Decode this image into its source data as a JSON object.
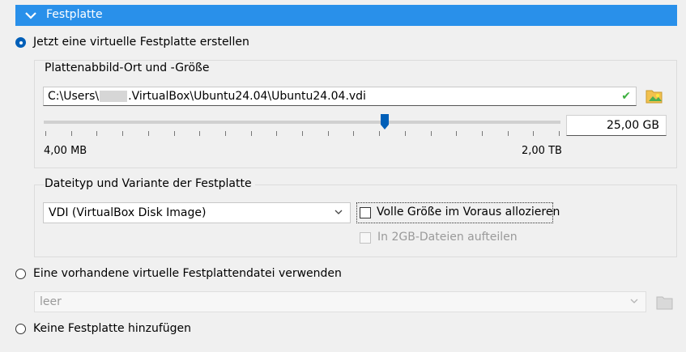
{
  "section": {
    "title": "Festplatte"
  },
  "options": {
    "create_new": {
      "label": "Jetzt eine virtuelle Festplatte erstellen",
      "selected": true
    },
    "use_existing": {
      "label": "Eine vorhandene virtuelle Festplattendatei verwenden",
      "selected": false
    },
    "no_disk": {
      "label": "Keine Festplatte hinzufügen",
      "selected": false
    }
  },
  "location_group": {
    "title": "Plattenabbild-Ort und -Größe",
    "path_prefix": "C:\\Users\\",
    "path_suffix": ".VirtualBox\\Ubuntu24.04\\Ubuntu24.04.vdi",
    "size_value": "25,00 GB",
    "slider_min_label": "4,00 MB",
    "slider_max_label": "2,00 TB",
    "slider_position_fraction": 0.66
  },
  "type_group": {
    "title": "Dateityp und Variante der Festplatte",
    "disk_type": "VDI (VirtualBox Disk Image)",
    "preallocate_label": "Volle Größe im Voraus allozieren",
    "preallocate_checked": false,
    "split_label": "In 2GB-Dateien aufteilen",
    "split_checked": false
  },
  "existing_disk": {
    "value": "leer"
  },
  "icons": {
    "header": "chevron-down-icon",
    "browse": "folder-browse-icon",
    "valid": "checkmark-icon",
    "select_arrow": "chevron-down-icon"
  },
  "colors": {
    "header_bg": "#2990ea",
    "accent": "#005fb8",
    "check": "#3db040"
  }
}
